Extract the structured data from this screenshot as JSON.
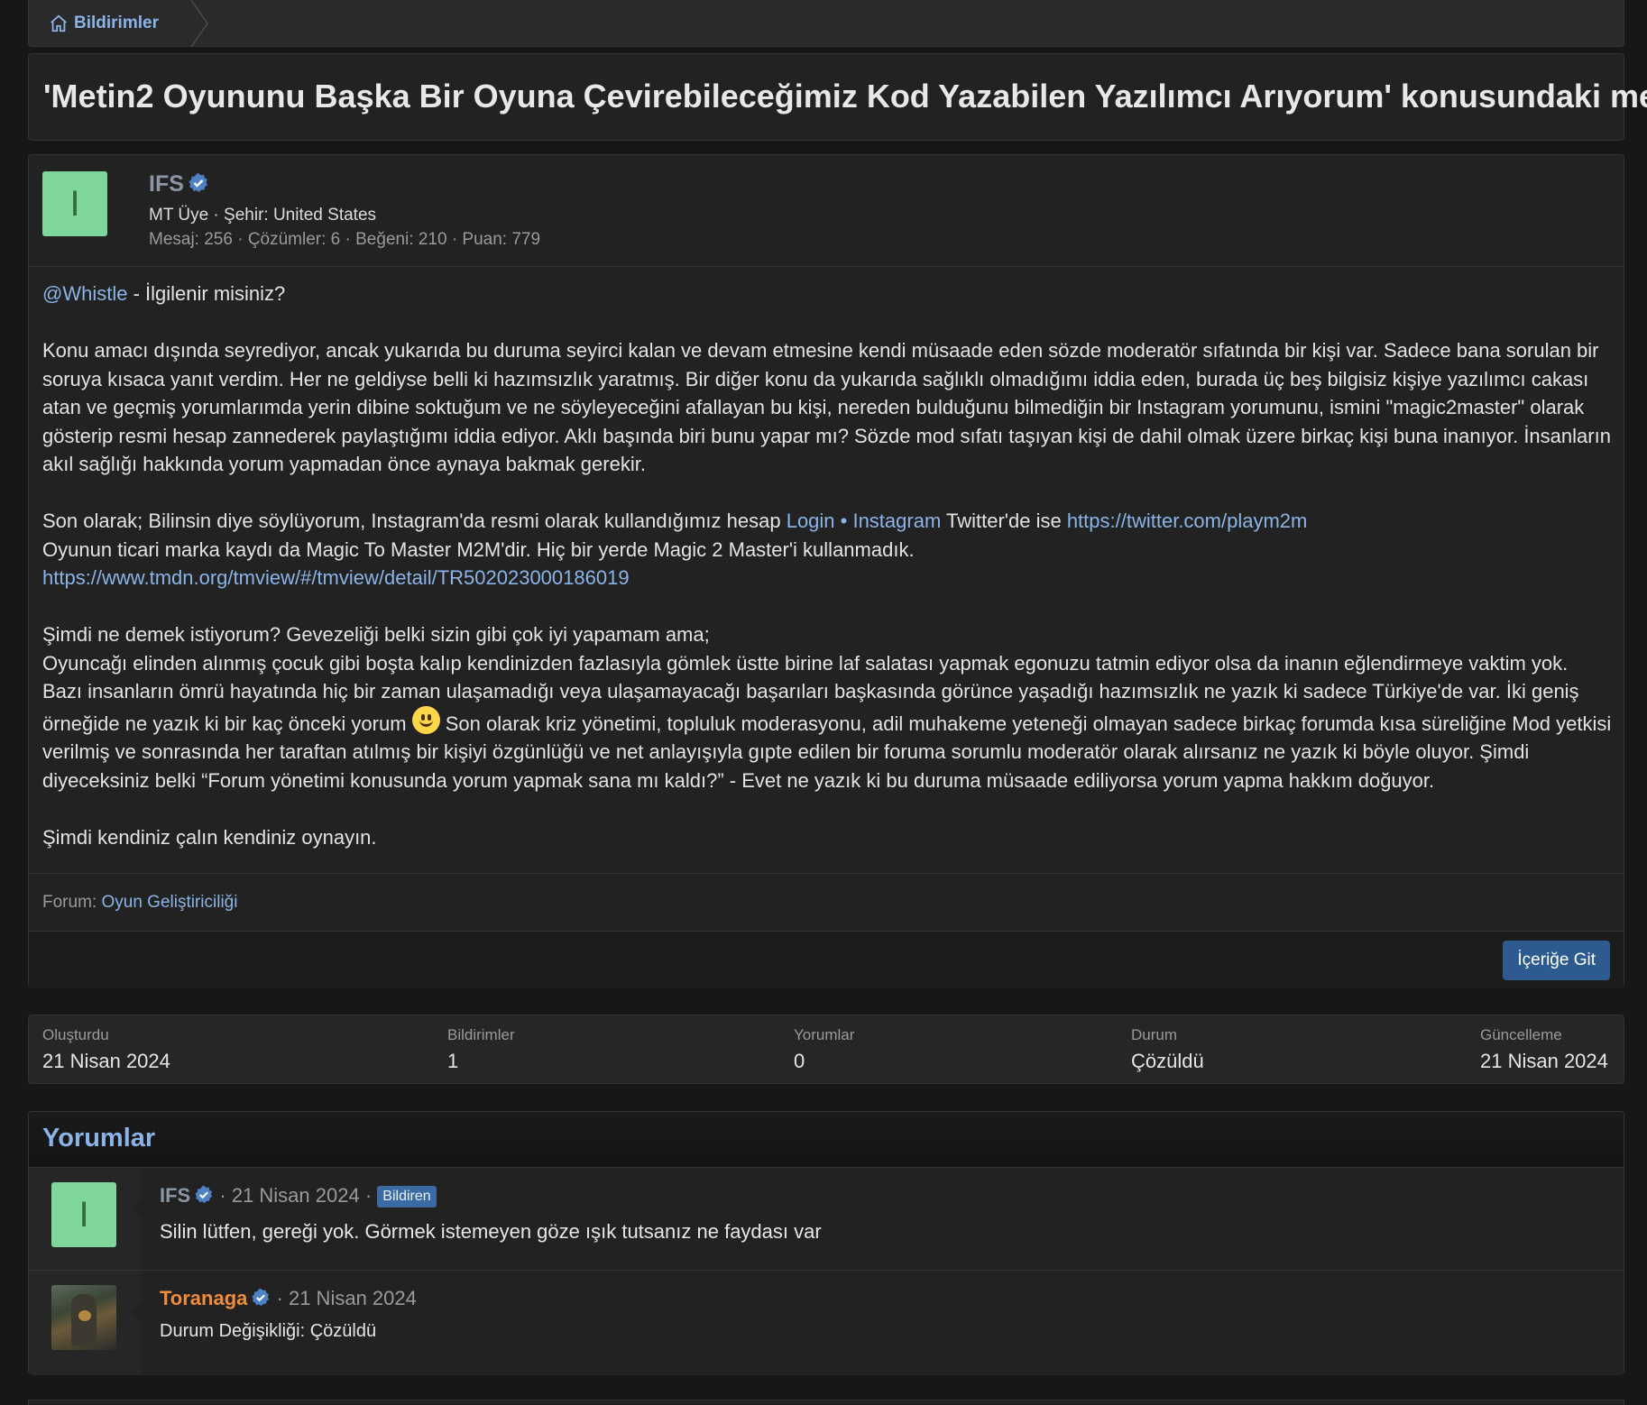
{
  "breadcrumb": {
    "label": "Bildirimler"
  },
  "page_title": "'Metin2 Oyununu Başka Bir Oyuna Çevirebileceğimiz Kod Yazabilen Yazılımcı Arıyorum' konusundaki mesaj",
  "post": {
    "avatar_letter": "I",
    "username": "IFS",
    "meta1": "MT Üye · Şehir: United States",
    "meta2": "Mesaj: 256 · Çözümler: 6 · Beğeni: 210 · Puan: 779",
    "mention": "@Whistle",
    "p1_rest": " - İlgilenir misiniz?",
    "p2": "Konu amacı dışında seyrediyor, ancak yukarıda bu duruma seyirci kalan ve devam etmesine kendi müsaade eden sözde moderatör sıfatında bir kişi var. Sadece bana sorulan bir soruya kısaca yanıt verdim. Her ne geldiyse belli ki hazımsızlık yaratmış. Bir diğer konu da yukarıda sağlıklı olmadığımı iddia eden, burada üç beş bilgisiz kişiye yazılımcı cakası atan ve geçmiş yorumlarımda yerin dibine soktuğum ve ne söyleyeceğini afallayan bu kişi, nereden bulduğunu bilmediğin bir Instagram yorumunu, ismini \"magic2master\" olarak gösterip resmi hesap zannederek paylaştığımı iddia ediyor. Aklı başında biri bunu yapar mı? Sözde mod sıfatı taşıyan kişi de dahil olmak üzere birkaç kişi buna inanıyor. İnsanların akıl sağlığı hakkında yorum yapmadan önce aynaya bakmak gerekir.",
    "p3_a": "Son olarak; Bilinsin diye söylüyorum, Instagram'da resmi olarak kullandığımız hesap ",
    "p3_link1": "Login • Instagram",
    "p3_b": " Twitter'de ise ",
    "p3_link2": "https://twitter.com/playm2m",
    "p3_line2": "Oyunun ticari marka kaydı da Magic To Master M2M'dir. Hiç bir yerde Magic 2 Master'i kullanmadık.",
    "p3_link3": "https://www.tmdn.org/tmview/#/tmview/detail/TR502023000186019",
    "p4_line1": "Şimdi ne demek istiyorum? Gevezeliği belki sizin gibi çok iyi yapamam ama;",
    "p4_a": "Oyuncağı elinden alınmış çocuk gibi boşta kalıp kendinizden fazlasıyla gömlek üstte birine laf salatası yapmak egonuzu tatmin ediyor olsa da inanın eğlendirmeye vaktim yok. Bazı insanların ömrü hayatında hiç bir zaman ulaşamadığı veya ulaşamayacağı başarıları başkasında görünce yaşadığı hazımsızlık ne yazık ki sadece Türkiye'de var. İki geniş örneğide ne yazık ki bir kaç önceki yorum ",
    "p4_b": " Son olarak kriz yönetimi, topluluk moderasyonu, adil muhakeme yeteneği olmayan sadece birkaç forumda kısa süreliğine Mod yetkisi verilmiş ve sonrasında her taraftan atılmış bir kişiyi özgünlüğü ve net anlayışıyla gıpte edilen bir foruma sorumlu moderatör olarak alırsanız ne yazık ki böyle oluyor. Şimdi diyeceksiniz belki “Forum yönetimi konusunda yorum yapmak sana mı kaldı?” - Evet ne yazık ki bu duruma müsaade ediliyorsa yorum yapma hakkım doğuyor.",
    "p5": "Şimdi kendiniz çalın kendiniz oynayın.",
    "forum_label": "Forum:",
    "forum_link": "Oyun Geliştiriciliği",
    "goto_button": "İçeriğe Git"
  },
  "stats": [
    {
      "label": "Oluşturdu",
      "value": "21 Nisan 2024"
    },
    {
      "label": "Bildirimler",
      "value": "1"
    },
    {
      "label": "Yorumlar",
      "value": "0"
    },
    {
      "label": "Durum",
      "value": "Çözüldü"
    },
    {
      "label": "Güncelleme",
      "value": "21 Nisan 2024"
    }
  ],
  "comments": {
    "title": "Yorumlar",
    "items": [
      {
        "avatar_letter": "I",
        "username": "IFS",
        "date": "21 Nisan 2024",
        "badge": "Bildiren",
        "text": "Silin lütfen, gereği yok. Görmek istemeyen göze ışık tutsanız ne faydası var"
      },
      {
        "username": "Toranaga",
        "date": "21 Nisan 2024",
        "text": "Durum Değişikliği: Çözüldü"
      }
    ]
  },
  "colors": {
    "link": "#8ab4e8",
    "avatar_bg": "#7fd69a",
    "staff_name": "#f08c3a",
    "button": "#2d5b8f",
    "badge": "#3c6aa3"
  },
  "separator": "·"
}
